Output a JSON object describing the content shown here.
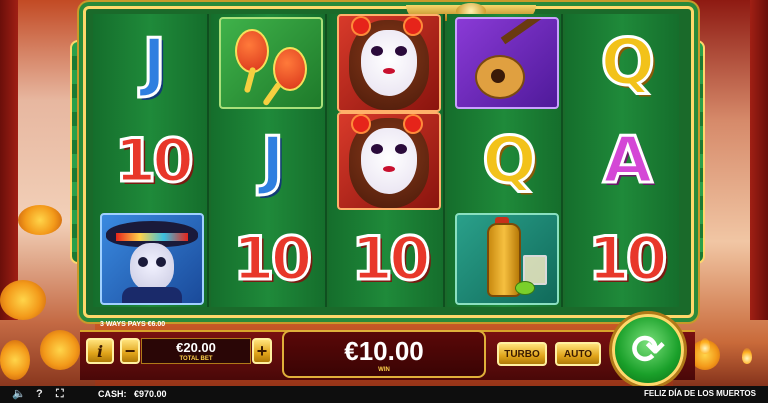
{
  "reels": {
    "col1": [
      "J",
      "10",
      "skull-man"
    ],
    "col2": [
      "maracas",
      "J",
      "10"
    ],
    "col3": [
      "catrina",
      "catrina",
      "10"
    ],
    "col4": [
      "guitar",
      "Q",
      "tequila"
    ],
    "col5": [
      "Q",
      "A",
      "10"
    ]
  },
  "symbols": {
    "r1c1": "J",
    "r2c1": "10",
    "r2c2": "J",
    "r3c2": "10",
    "r3c3": "10",
    "r2c4": "Q",
    "r1c5": "Q",
    "r2c5": "A",
    "r3c5": "10"
  },
  "ways_pays": "3 WAYS PAYS €6.00",
  "bet": {
    "value": "€20.00",
    "label": "TOTAL BET",
    "minus": "−",
    "plus": "+"
  },
  "info_label": "i",
  "win": {
    "value": "€10.00",
    "label": "WIN"
  },
  "turbo_label": "TURBO",
  "auto_label": "AUTO",
  "status": {
    "cash_label": "CASH:",
    "cash_value": "€970.00",
    "game_name": "FELIZ DÍA DE LOS MUERTOS"
  },
  "icons": [
    "sound-icon",
    "help-icon",
    "fullscreen-icon",
    "spin-icon"
  ],
  "colors": {
    "reel_green": "#1f8a3a",
    "frame_gold": "#ffd86a",
    "panel_red": "#5a0808",
    "spin_green": "#1aa02a"
  }
}
